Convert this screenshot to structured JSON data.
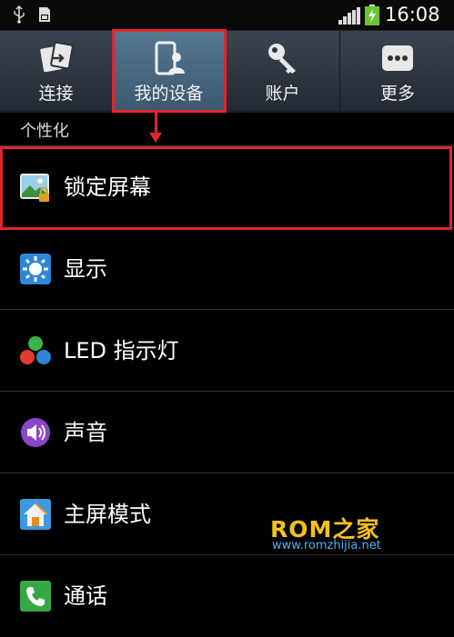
{
  "status_bar": {
    "time": "16:08",
    "icons": [
      "usb-icon",
      "sd-card-icon",
      "signal-icon",
      "battery-charging-icon"
    ]
  },
  "tabs": [
    {
      "label": "连接",
      "icon": "connect-icon",
      "selected": false
    },
    {
      "label": "我的设备",
      "icon": "my-device-icon",
      "selected": true
    },
    {
      "label": "账户",
      "icon": "key-icon",
      "selected": false
    },
    {
      "label": "更多",
      "icon": "more-icon",
      "selected": false
    }
  ],
  "section": {
    "title": "个性化"
  },
  "items": [
    {
      "label": "锁定屏幕",
      "icon": "lock-screen-icon"
    },
    {
      "label": "显示",
      "icon": "display-icon"
    },
    {
      "label": "LED 指示灯",
      "icon": "led-icon"
    },
    {
      "label": "声音",
      "icon": "sound-icon"
    },
    {
      "label": "主屏模式",
      "icon": "home-screen-icon"
    },
    {
      "label": "通话",
      "icon": "call-icon"
    }
  ],
  "watermark": {
    "logo": "ROM之家",
    "url": "www.romzhijia.net"
  },
  "colors": {
    "highlight": "#e0262b",
    "selected_tab": "#4a6a83",
    "tab_bar": "#2e3640",
    "watermark_logo": "#f3c11a",
    "watermark_url": "#4fb2f0"
  }
}
